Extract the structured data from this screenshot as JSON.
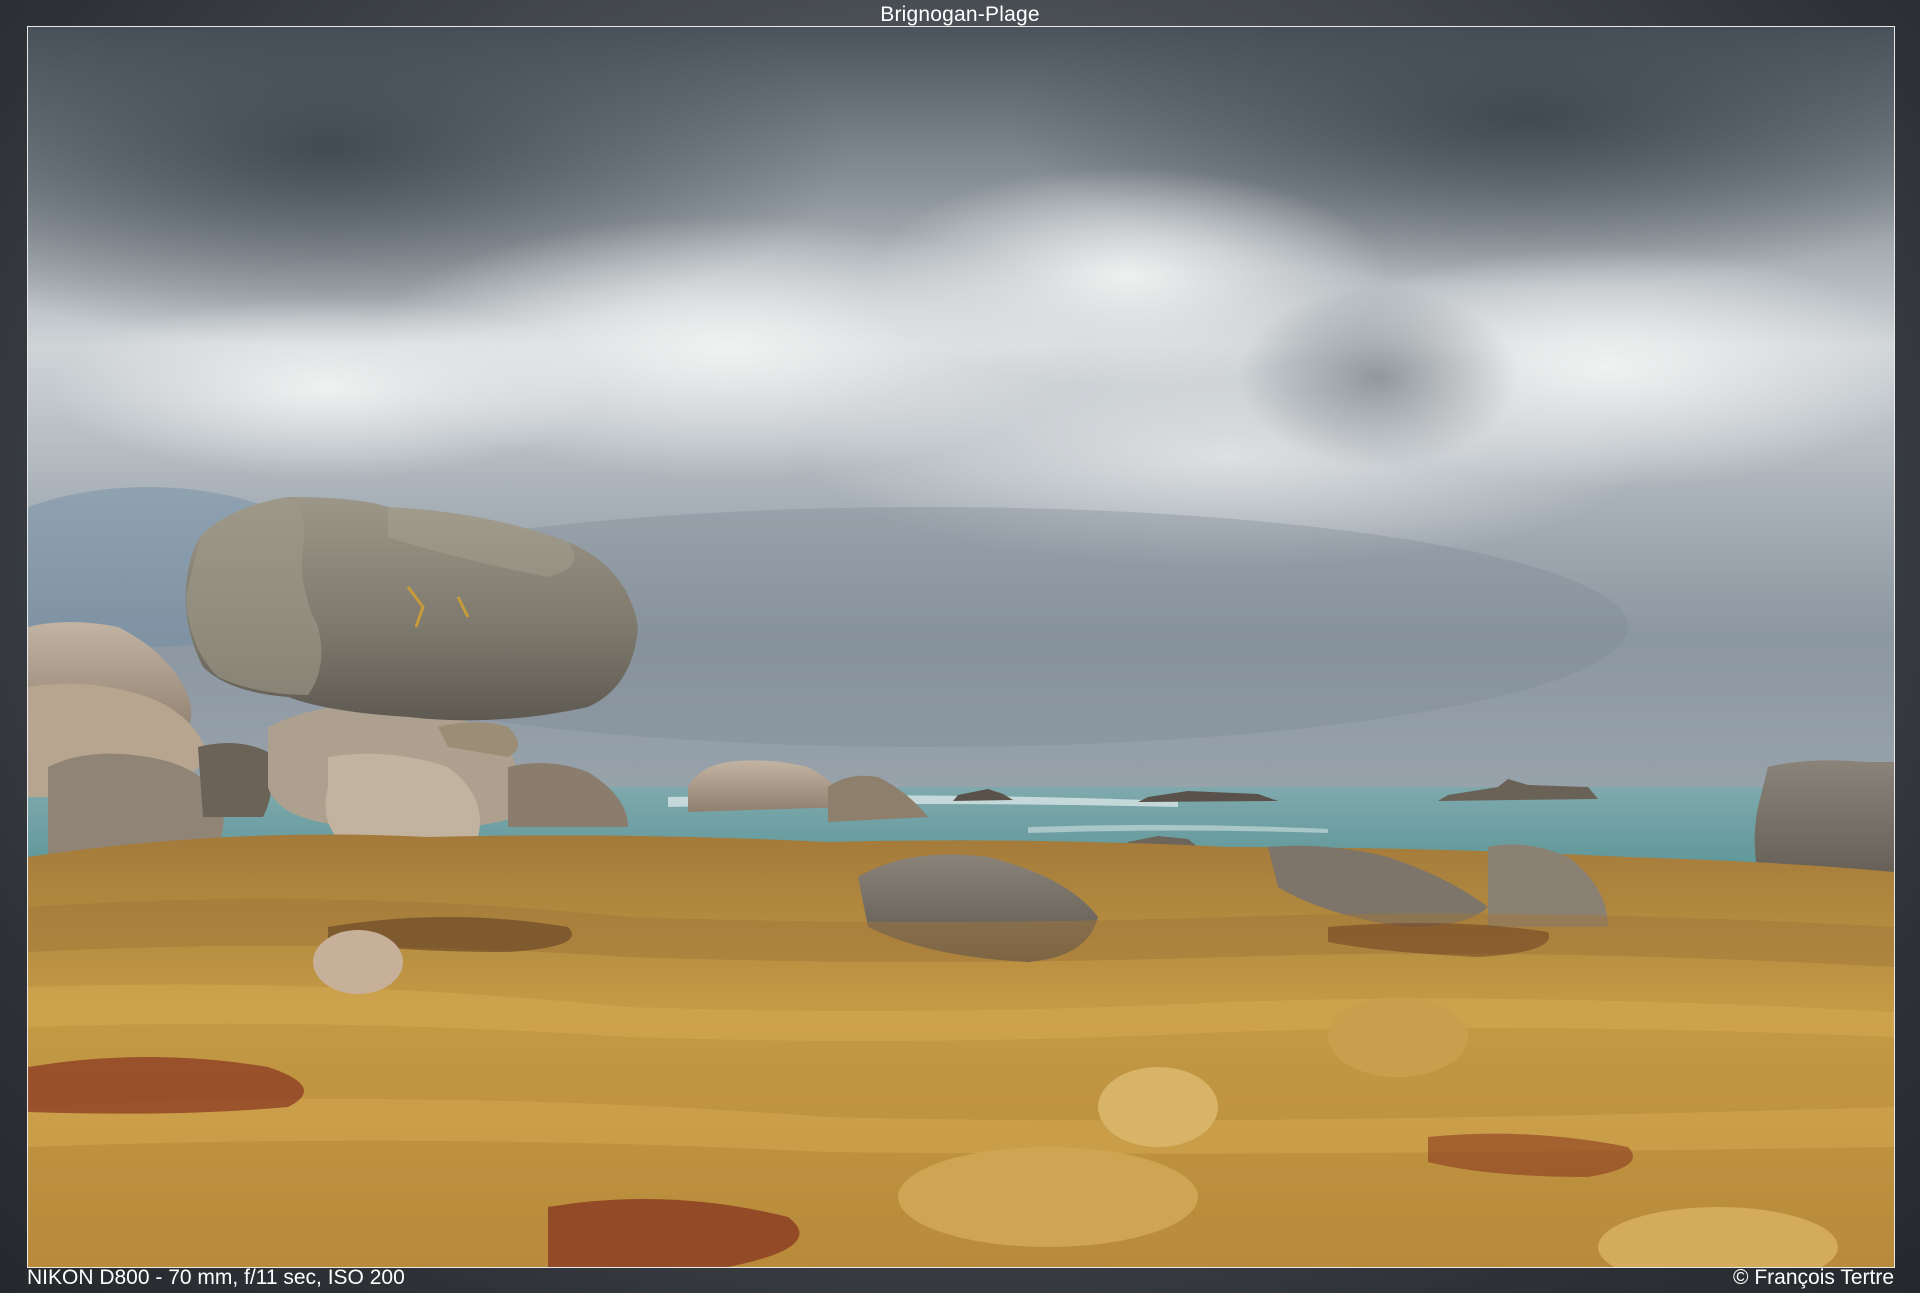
{
  "title": "Brignogan-Plage",
  "exif": "NIKON D800 - 70 mm, f/11 sec, ISO 200",
  "copyright": "© François Tertre",
  "photo": {
    "subject": "balanced-granite-boulder-coast",
    "colors": {
      "sky_dark": "#4b5560",
      "sky_light": "#d6dadd",
      "sea": "#5f9a9c",
      "rock_yellow": "#c89a3c",
      "rock_grey": "#8a857a",
      "seaweed": "#8a3a22"
    }
  }
}
